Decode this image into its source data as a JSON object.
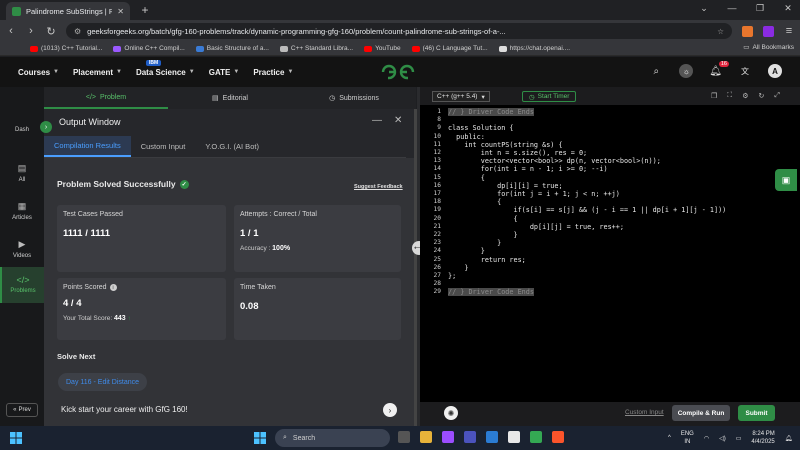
{
  "browser": {
    "tab_title": "Palindrome SubStrings | Practice",
    "url": "geeksforgeeks.org/batch/gfg-160-problems/track/dynamic-programming-gfg-160/problem/count-palindrome-sub-strings-of-a-...",
    "bookmarks": [
      {
        "label": "(1013) C++ Tutorial...",
        "color": "#ff0000"
      },
      {
        "label": "Online C++ Compil...",
        "color": "#9b59ff"
      },
      {
        "label": "Basic Structure of a...",
        "color": "#3a7bd5"
      },
      {
        "label": "C++ Standard Libra...",
        "color": "#bbbbbb"
      },
      {
        "label": "YouTube",
        "color": "#ff0000"
      },
      {
        "label": "(46) C Language Tut...",
        "color": "#ff0000"
      },
      {
        "label": "https://chat.openai....",
        "color": "#dddddd"
      }
    ],
    "all_bookmarks": "All Bookmarks"
  },
  "gfg_nav": {
    "items": [
      "Courses",
      "Placement",
      "Data Science",
      "GATE",
      "Practice"
    ],
    "ibm_badge": "IBM",
    "notif_count": "16",
    "avatar_letter": "A"
  },
  "rail": {
    "items": [
      "Dash",
      "All",
      "Articles",
      "Videos",
      "Problems"
    ],
    "prev": "Prev"
  },
  "problem_tabs": [
    "Problem",
    "Editorial",
    "Submissions"
  ],
  "output": {
    "title": "Output Window",
    "tabs": [
      "Compilation Results",
      "Custom Input",
      "Y.O.G.I. (AI Bot)"
    ],
    "status": "Problem Solved Successfully",
    "suggest": "Suggest Feedback",
    "cards": {
      "test_label": "Test Cases Passed",
      "test_value": "1111 / 1111",
      "attempts_label": "Attempts : Correct / Total",
      "attempts_value": "1 / 1",
      "accuracy_label": "Accuracy :",
      "accuracy_value": "100%",
      "points_label": "Points Scored",
      "points_value": "4 / 4",
      "total_label": "Your Total Score:",
      "total_value": "443",
      "time_label": "Time Taken",
      "time_value": "0.08"
    },
    "solve_next": "Solve Next",
    "next_problem": "Day 116 - Edit Distance",
    "kick": "Kick start your career with GfG 160!"
  },
  "editor": {
    "language": "C++ (g++ 5.4)",
    "timer": "Start Timer",
    "line_numbers": [
      "1",
      "8",
      "9",
      "10",
      "11",
      "12",
      "13",
      "14",
      "15",
      "16",
      "17",
      "18",
      "19",
      "20",
      "21",
      "22",
      "23",
      "24",
      "25",
      "26",
      "27",
      "28",
      "29"
    ],
    "lines": [
      "// } Driver Code Ends",
      "",
      "class Solution {",
      "  public:",
      "    int countPS(string &s) {",
      "        int n = s.size(), res = 0;",
      "        vector<vector<bool>> dp(n, vector<bool>(n));",
      "        for(int i = n - 1; i >= 0; --i)",
      "        {",
      "            dp[i][i] = true;",
      "            for(int j = i + 1; j < n; ++j)",
      "            {",
      "                if(s[i] == s[j] && (j - i == 1 || dp[i + 1][j - 1]))",
      "                {",
      "                    dp[i][j] = true, res++;",
      "                }",
      "            }",
      "        }",
      "        return res;",
      "    }",
      "};",
      "",
      "// } Driver Code Ends"
    ],
    "custom_input": "Custom Input",
    "compile": "Compile & Run",
    "submit": "Submit"
  },
  "taskbar": {
    "search": "Search",
    "lang_top": "ENG",
    "lang_bottom": "IN",
    "time": "8:24 PM",
    "date": "4/4/2025"
  },
  "colors": {
    "brand_green": "#2f8d46",
    "accent_blue": "#4a9eff"
  }
}
